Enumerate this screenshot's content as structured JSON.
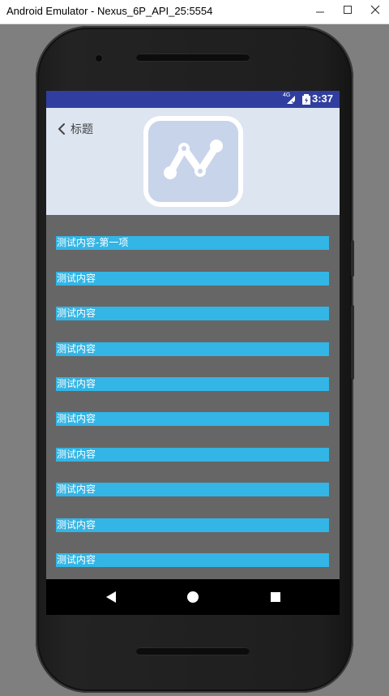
{
  "window": {
    "title": "Android Emulator - Nexus_6P_API_25:5554"
  },
  "statusbar": {
    "network": "4G",
    "time": "3:37"
  },
  "header": {
    "back_label": "标题"
  },
  "list": {
    "items": [
      "测试内容-第一项",
      "测试内容",
      "测试内容",
      "测试内容",
      "测试内容",
      "测试内容",
      "测试内容",
      "测试内容",
      "测试内容",
      "测试内容"
    ]
  },
  "colors": {
    "statusbar": "#303f9f",
    "header_bg": "#dde5f1",
    "list_bg": "#666666",
    "item_bg": "#33b5e5",
    "navbar": "#000000"
  },
  "icons": {
    "back": "chevron-left-icon",
    "logo": "app-logo-icon",
    "nav_back": "triangle-back-icon",
    "nav_home": "circle-home-icon",
    "nav_recent": "square-recents-icon"
  }
}
